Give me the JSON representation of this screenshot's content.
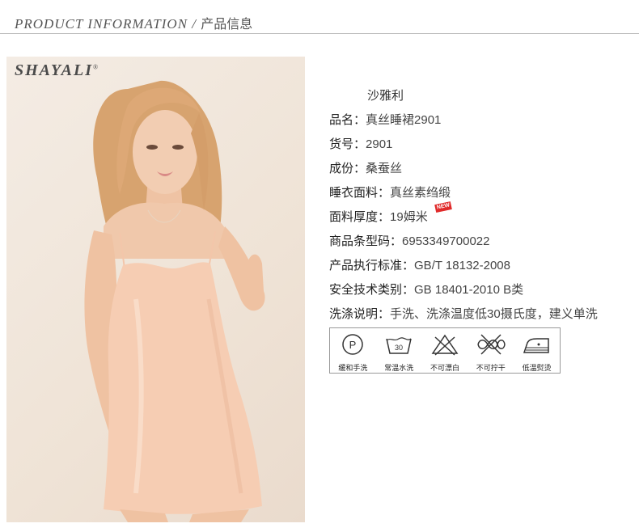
{
  "header": {
    "title_en": "PRODUCT INFORMATION",
    "separator": " / ",
    "title_cn": "产品信息"
  },
  "photo": {
    "brand_logo": "SHAYALI",
    "brand_mark": "®"
  },
  "specs": {
    "brand_name": "沙雅利",
    "rows": [
      {
        "key": "品名：",
        "value": "真丝睡裙2901"
      },
      {
        "key": "货号：",
        "value": "2901"
      },
      {
        "key": "成份：",
        "value": "桑蚕丝"
      },
      {
        "key": "睡衣面料：",
        "value": "真丝素绉缎"
      },
      {
        "key": "面料厚度：",
        "value": "19姆米",
        "badge": "NEW"
      },
      {
        "key": "商品条型码：",
        "value": "6953349700022"
      },
      {
        "key": "产品执行标准：",
        "value": "GB/T 18132-2008"
      },
      {
        "key": "安全技术类别：",
        "value": "GB 18401-2010 B类"
      },
      {
        "key": "洗涤说明：",
        "value": "手洗、洗涤温度低30摄氏度，建义单洗"
      }
    ]
  },
  "care": [
    {
      "icon": "dry-clean-p-icon",
      "label": "缓和手洗"
    },
    {
      "icon": "wash-30-icon",
      "label": "常温水洗",
      "number": "30"
    },
    {
      "icon": "no-bleach-icon",
      "label": "不可漂白"
    },
    {
      "icon": "no-wring-icon",
      "label": "不可拧干"
    },
    {
      "icon": "low-iron-icon",
      "label": "低温熨烫"
    }
  ],
  "colors": {
    "garment": "#f6cdb3",
    "hair": "#d9a774",
    "rule": "#bdbdbd"
  }
}
